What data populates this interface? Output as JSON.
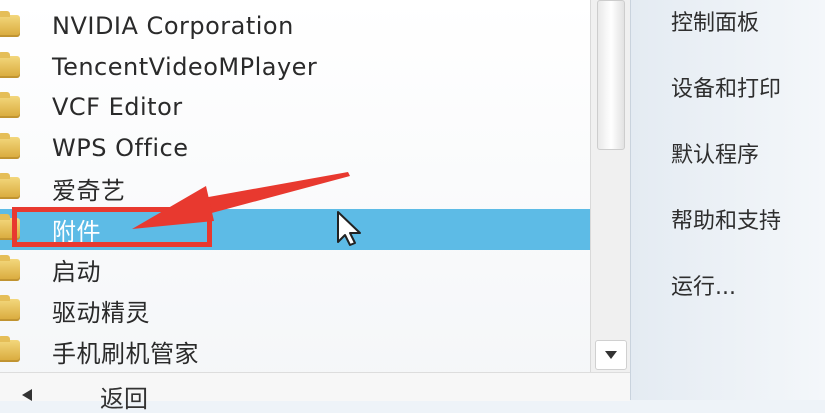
{
  "program_list": {
    "items": [
      {
        "label": "NVIDIA Corporation"
      },
      {
        "label": "TencentVideoMPlayer"
      },
      {
        "label": "VCF Editor"
      },
      {
        "label": "WPS Office"
      },
      {
        "label": "爱奇艺"
      },
      {
        "label": "附件"
      },
      {
        "label": "启动"
      },
      {
        "label": "驱动精灵"
      },
      {
        "label": "手机刷机管家"
      }
    ],
    "back_label": "返回"
  },
  "right_menu": {
    "items": [
      {
        "label": "控制面板"
      },
      {
        "label": "设备和打印"
      },
      {
        "label": "默认程序"
      },
      {
        "label": "帮助和支持"
      },
      {
        "label": "运行..."
      }
    ]
  },
  "icons": {
    "folder": "folder-icon",
    "scroll_down": "chevron-down-icon",
    "back": "back-arrow-icon",
    "cursor": "mouse-cursor-icon"
  },
  "colors": {
    "selection": "#5dbbe6",
    "annotation": "#e8392f",
    "folder": "#d8a93a"
  }
}
